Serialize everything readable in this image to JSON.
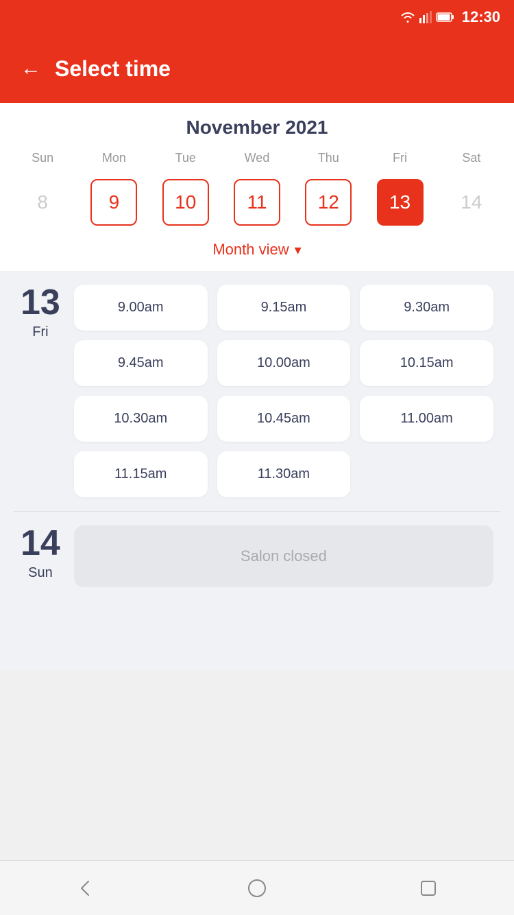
{
  "statusBar": {
    "time": "12:30"
  },
  "header": {
    "backLabel": "←",
    "title": "Select time"
  },
  "calendar": {
    "monthYear": "November 2021",
    "weekdays": [
      "Sun",
      "Mon",
      "Tue",
      "Wed",
      "Thu",
      "Fri",
      "Sat"
    ],
    "dates": [
      {
        "number": "8",
        "state": "inactive"
      },
      {
        "number": "9",
        "state": "outlined"
      },
      {
        "number": "10",
        "state": "outlined"
      },
      {
        "number": "11",
        "state": "outlined"
      },
      {
        "number": "12",
        "state": "outlined"
      },
      {
        "number": "13",
        "state": "active"
      },
      {
        "number": "14",
        "state": "inactive"
      }
    ],
    "monthViewLabel": "Month view"
  },
  "days": [
    {
      "number": "13",
      "name": "Fri",
      "slots": [
        "9.00am",
        "9.15am",
        "9.30am",
        "9.45am",
        "10.00am",
        "10.15am",
        "10.30am",
        "10.45am",
        "11.00am",
        "11.15am",
        "11.30am"
      ]
    },
    {
      "number": "14",
      "name": "Sun",
      "slots": [],
      "closedLabel": "Salon closed"
    }
  ],
  "navBar": {
    "back": "back",
    "home": "home",
    "recent": "recent"
  }
}
